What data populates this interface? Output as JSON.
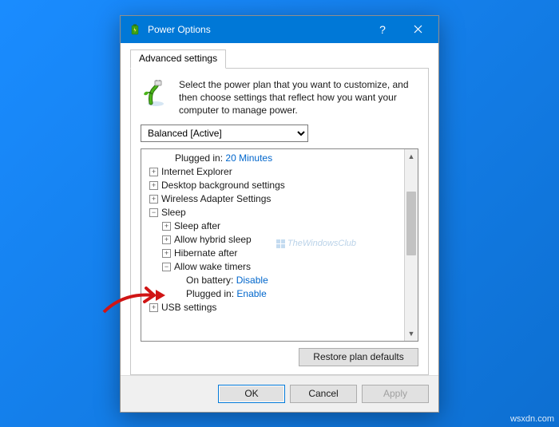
{
  "window": {
    "title": "Power Options"
  },
  "tab": {
    "label": "Advanced settings"
  },
  "intro": "Select the power plan that you want to customize, and then choose settings that reflect how you want your computer to manage power.",
  "plan": {
    "selected": "Balanced [Active]"
  },
  "tree": {
    "plugged_in_top": {
      "label": "Plugged in:",
      "value": "20 Minutes"
    },
    "ie": "Internet Explorer",
    "desktop_bg": "Desktop background settings",
    "wireless": "Wireless Adapter Settings",
    "sleep": "Sleep",
    "sleep_after": "Sleep after",
    "hybrid": "Allow hybrid sleep",
    "hibernate": "Hibernate after",
    "wake_timers": "Allow wake timers",
    "on_battery": {
      "label": "On battery:",
      "value": "Disable"
    },
    "plugged_in": {
      "label": "Plugged in:",
      "value": "Enable"
    },
    "usb": "USB settings"
  },
  "buttons": {
    "restore": "Restore plan defaults",
    "ok": "OK",
    "cancel": "Cancel",
    "apply": "Apply"
  },
  "watermark": "TheWindowsClub",
  "credit": "wsxdn.com"
}
